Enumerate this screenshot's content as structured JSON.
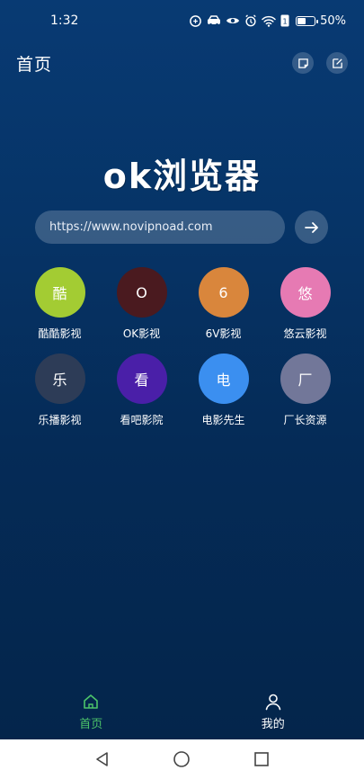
{
  "status": {
    "time": "1:32",
    "battery_text": "50%",
    "battery_level": 0.5,
    "icons": [
      "alarm-clock-icon",
      "wifi-icon",
      "battery-icon"
    ]
  },
  "header": {
    "title": "首页"
  },
  "logo": {
    "text": "ok浏览器"
  },
  "urlbar": {
    "value": "https://www.novipnoad.com"
  },
  "sites": [
    {
      "glyph": "酷",
      "label": "酷酷影视",
      "color": "#a3cc33"
    },
    {
      "glyph": "O",
      "label": "OK影视",
      "color": "#4a1a1f"
    },
    {
      "glyph": "6",
      "label": "6V影视",
      "color": "#d9863c"
    },
    {
      "glyph": "悠",
      "label": "悠云影视",
      "color": "#e67ab3"
    },
    {
      "glyph": "乐",
      "label": "乐播影视",
      "color": "#2d3c57"
    },
    {
      "glyph": "看",
      "label": "看吧影院",
      "color": "#4a1fa8"
    },
    {
      "glyph": "电",
      "label": "电影先生",
      "color": "#3b8ff0"
    },
    {
      "glyph": "厂",
      "label": "厂长资源",
      "color": "#727799"
    }
  ],
  "nav": {
    "home_label": "首页",
    "mine_label": "我的",
    "active_color": "#4cc46a"
  }
}
